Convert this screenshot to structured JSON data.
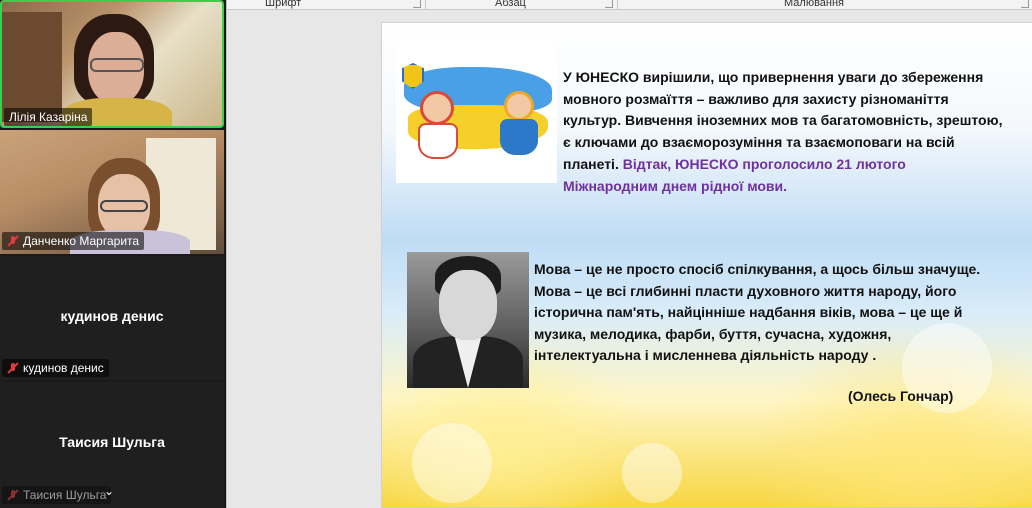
{
  "participants": [
    {
      "name": "Лілія Казаріна",
      "video": true,
      "muted": false
    },
    {
      "name": "Данченко Маргарита",
      "video": true,
      "muted": true
    },
    {
      "name": "кудинов денис",
      "video": false,
      "muted": true
    },
    {
      "name": "Таисия Шульга",
      "video": false,
      "muted": true
    }
  ],
  "ribbon": {
    "groups": [
      "Шрифт",
      "Абзац",
      "Малювання"
    ]
  },
  "slide": {
    "paragraph1": "У ЮНЕСКО вирішили, що привернення уваги до збереження мовного розмаїття – важливо для захисту різноманіття культур. Вивчення іноземних мов та багатомовність, зрештою, є ключами до взаєморозуміння та взаємоповаги на всій планеті.",
    "paragraph1_highlight": "Відтак, ЮНЕСКО проголосило 21 лютого Міжнародним днем рідної мови.",
    "quote": "Мова – це не просто спосіб спілкування, а щось більш значуще. Мова – це всі глибинні пласти духовного життя народу, його історична пам'ять, найцінніше надбання віків, мова – це ще й музика, мелодика, фарби, буття, сучасна, художня, інтелектуальна і мисленнева діяльність народу .",
    "author": "(Олесь Гончар)"
  },
  "colors": {
    "active_speaker_border": "#3ccf4e",
    "highlight_text": "#7030a0",
    "muted_icon": "#e23b3b"
  },
  "icons": [
    "mic-off-icon",
    "chevron-down-icon",
    "dialog-launcher-icon"
  ]
}
